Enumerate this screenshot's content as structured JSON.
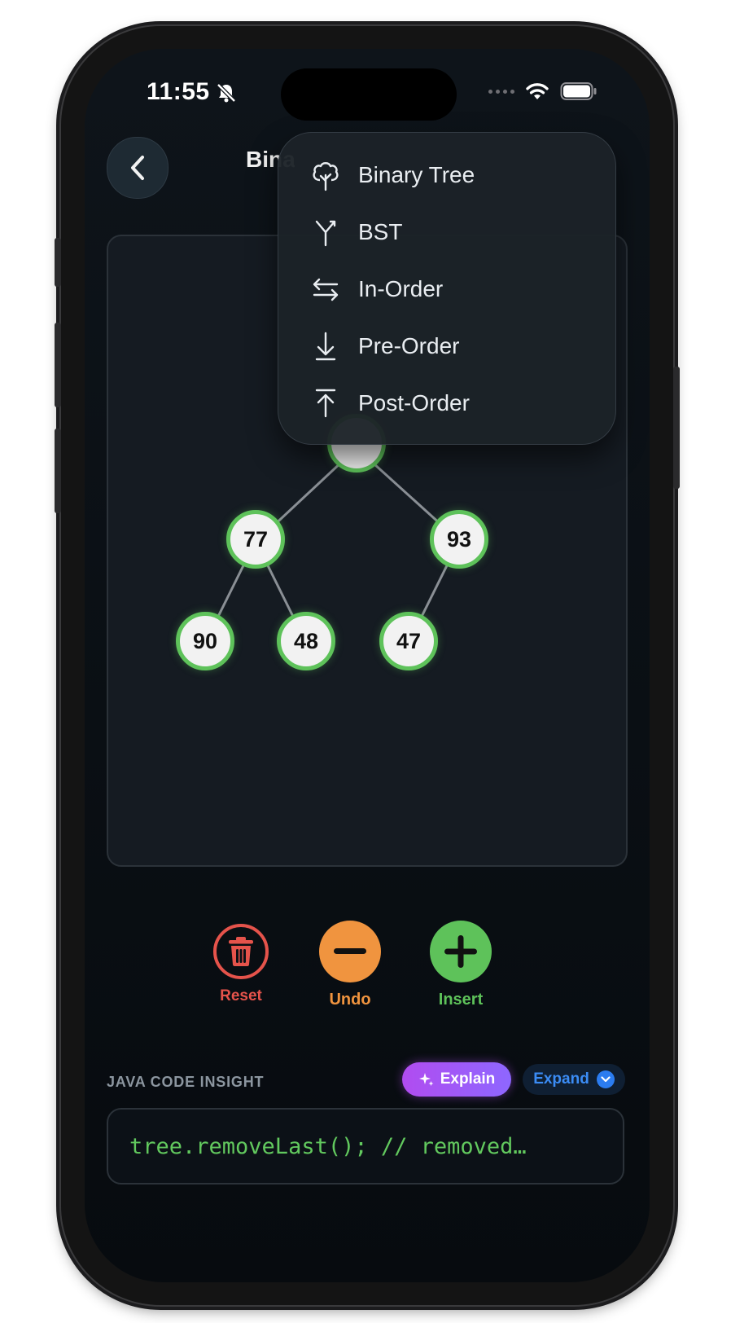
{
  "status_bar": {
    "time": "11:55"
  },
  "nav": {
    "title": "Bina"
  },
  "menu": {
    "items": [
      {
        "label": "Binary Tree",
        "icon": "tree-icon"
      },
      {
        "label": "BST",
        "icon": "branch-icon"
      },
      {
        "label": "In-Order",
        "icon": "arrows-left-right-icon"
      },
      {
        "label": "Pre-Order",
        "icon": "arrow-down-icon"
      },
      {
        "label": "Post-Order",
        "icon": "arrow-up-bar-icon"
      }
    ]
  },
  "tree": {
    "nodes": [
      {
        "id": "l",
        "value": "77"
      },
      {
        "id": "r",
        "value": "93"
      },
      {
        "id": "ll",
        "value": "90"
      },
      {
        "id": "lr",
        "value": "48"
      },
      {
        "id": "rl",
        "value": "47"
      }
    ]
  },
  "actions": {
    "reset_label": "Reset",
    "undo_label": "Undo",
    "insert_label": "Insert"
  },
  "insight": {
    "label": "JAVA CODE INSIGHT",
    "explain_label": "Explain",
    "expand_label": "Expand",
    "code": "tree.removeLast(); // removed…"
  },
  "colors": {
    "accent_green": "#5ec25a",
    "reset_red": "#e5534b",
    "undo_orange": "#f0943f",
    "explain_purple": "#b14cf0",
    "expand_blue": "#3b8cf5"
  }
}
